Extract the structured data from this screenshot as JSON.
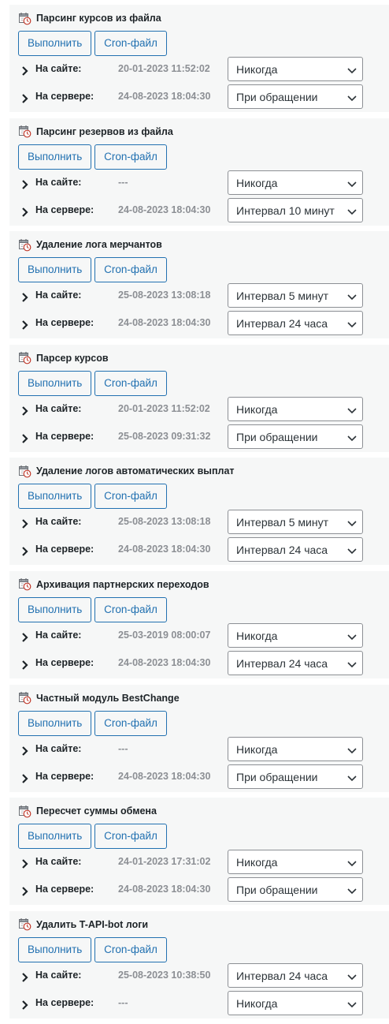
{
  "buttons": {
    "run_label": "Выполнить",
    "cron_label": "Cron-файл"
  },
  "labels": {
    "site": "На сайте:",
    "server": "На сервере:"
  },
  "icons": {
    "task": "calendar-clock-icon",
    "expand": "chevron-right-icon",
    "dropdown": "chevron-down-icon"
  },
  "colors": {
    "accent": "#2271b1",
    "card_bg": "#f6f7f7",
    "muted_text": "#8c8f94"
  },
  "tasks": [
    {
      "title": "Парсинг курсов из файла",
      "site_time": "20-01-2023 11:52:02",
      "site_interval": "Никогда",
      "server_time": "24-08-2023 18:04:30",
      "server_interval": "При обращении"
    },
    {
      "title": "Парсинг резервов из файла",
      "site_time": "---",
      "site_interval": "Никогда",
      "server_time": "24-08-2023 18:04:30",
      "server_interval": "Интервал 10 минут"
    },
    {
      "title": "Удаление лога мерчантов",
      "site_time": "25-08-2023 13:08:18",
      "site_interval": "Интервал 5 минут",
      "server_time": "24-08-2023 18:04:30",
      "server_interval": "Интервал 24 часа"
    },
    {
      "title": "Парсер курсов",
      "site_time": "20-01-2023 11:52:02",
      "site_interval": "Никогда",
      "server_time": "25-08-2023 09:31:32",
      "server_interval": "При обращении"
    },
    {
      "title": "Удаление логов автоматических выплат",
      "site_time": "25-08-2023 13:08:18",
      "site_interval": "Интервал 5 минут",
      "server_time": "24-08-2023 18:04:30",
      "server_interval": "Интервал 24 часа"
    },
    {
      "title": "Архивация партнерских переходов",
      "site_time": "25-03-2019 08:00:07",
      "site_interval": "Никогда",
      "server_time": "24-08-2023 18:04:30",
      "server_interval": "Интервал 24 часа"
    },
    {
      "title": "Частный модуль BestChange",
      "site_time": "---",
      "site_interval": "Никогда",
      "server_time": "24-08-2023 18:04:30",
      "server_interval": "При обращении"
    },
    {
      "title": "Пересчет суммы обмена",
      "site_time": "24-01-2023 17:31:02",
      "site_interval": "Никогда",
      "server_time": "24-08-2023 18:04:30",
      "server_interval": "При обращении"
    },
    {
      "title": "Удалить T-API-bot логи",
      "site_time": "25-08-2023 10:38:50",
      "site_interval": "Интервал 24 часа",
      "server_time": "---",
      "server_interval": "Никогда"
    }
  ]
}
